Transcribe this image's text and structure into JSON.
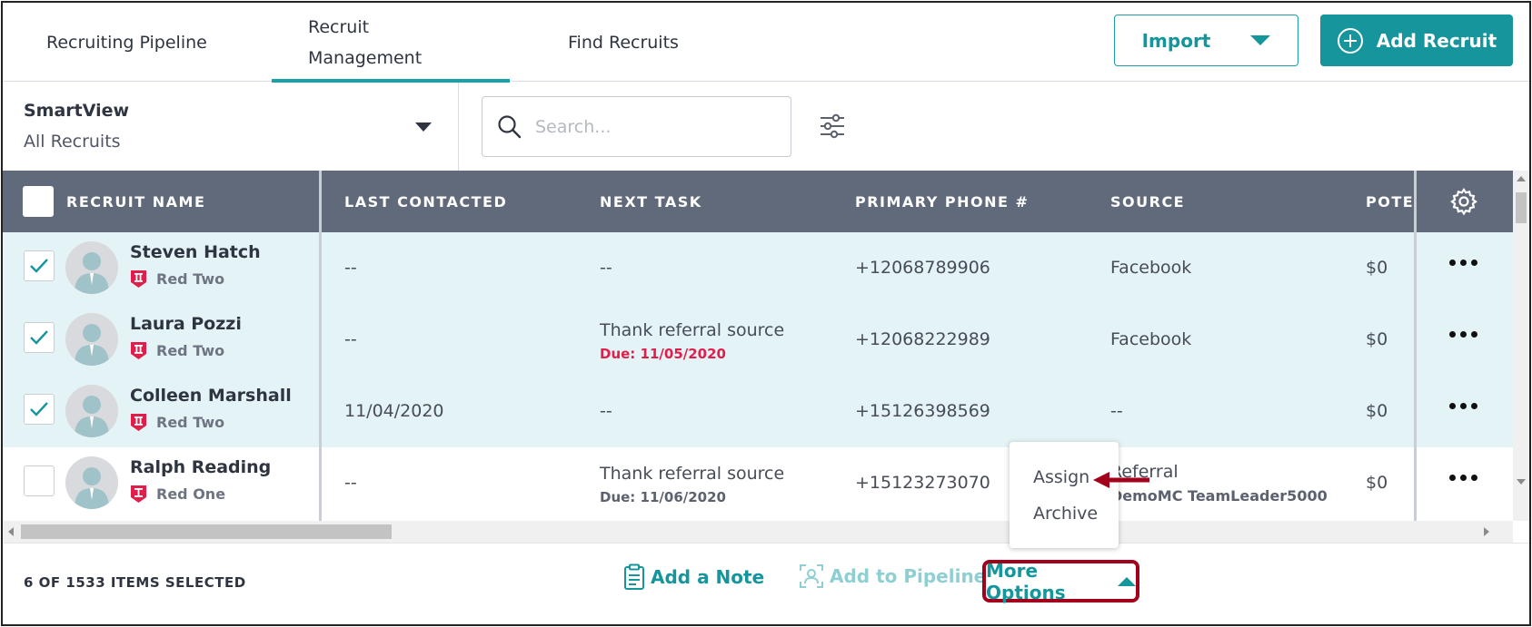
{
  "nav": {
    "tabs": [
      {
        "label": "Recruiting Pipeline"
      },
      {
        "label": "Recruit Management"
      },
      {
        "label": "Find Recruits"
      }
    ],
    "import_label": "Import",
    "add_label": "Add Recruit"
  },
  "smartview": {
    "title": "SmartView",
    "value": "All Recruits"
  },
  "search": {
    "placeholder": "Search..."
  },
  "table": {
    "columns": [
      "RECRUIT NAME",
      "LAST CONTACTED",
      "NEXT TASK",
      "PRIMARY PHONE #",
      "SOURCE",
      "POTE"
    ],
    "rows": [
      {
        "name": "Steven Hatch",
        "rank": "Red Two",
        "last": "--",
        "task": "--",
        "due": "",
        "phone": "+12068789906",
        "source": "Facebook",
        "source_sub": "",
        "pot": "$0",
        "checked": true
      },
      {
        "name": "Laura Pozzi",
        "rank": "Red Two",
        "last": "--",
        "task": "Thank referral source",
        "due": "Due: 11/05/2020",
        "phone": "+12068222989",
        "source": "Facebook",
        "source_sub": "",
        "pot": "$0",
        "checked": true
      },
      {
        "name": "Colleen Marshall",
        "rank": "Red Two",
        "last": "11/04/2020",
        "task": "--",
        "due": "",
        "phone": "+15126398569",
        "source": "--",
        "source_sub": "",
        "pot": "$0",
        "checked": true
      },
      {
        "name": "Ralph Reading",
        "rank": "Red One",
        "last": "--",
        "task": "Thank referral source",
        "due": "Due: 11/06/2020",
        "phone": "+15123273070",
        "source": "Referral",
        "source_sub": "DemoMC TeamLeader5000",
        "pot": "$0",
        "checked": false
      }
    ]
  },
  "footer": {
    "selected": "6 OF 1533 ITEMS SELECTED",
    "add_note": "Add a Note",
    "add_pipeline": "Add to Pipeline",
    "more_options": "More Options"
  },
  "menu": {
    "assign": "Assign",
    "archive": "Archive"
  },
  "colors": {
    "accent": "#17959d",
    "header_bg": "#616a7b",
    "selected_row": "#e4f3f6",
    "due_red": "#e01e4b",
    "highlight_red": "#a3001b"
  },
  "icons": {
    "badge_two": "rank-two-badge-icon",
    "badge_one": "rank-one-badge-icon"
  }
}
